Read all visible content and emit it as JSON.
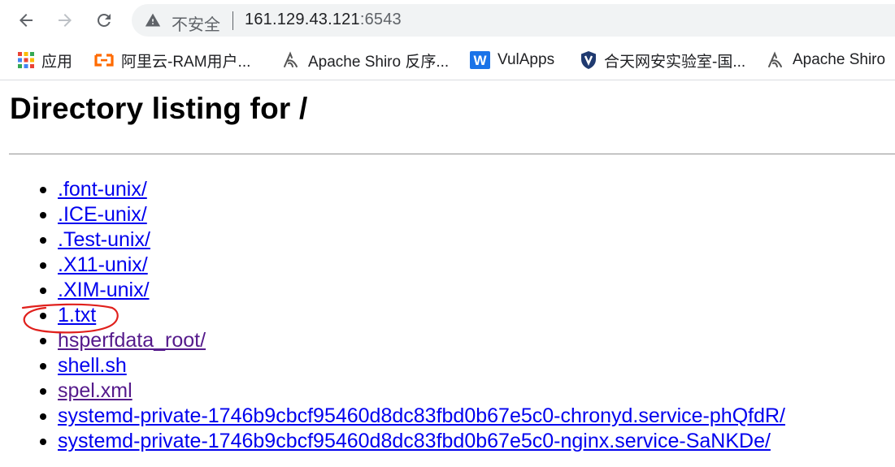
{
  "browser": {
    "security_label": "不安全",
    "url_host": "161.129.43.121",
    "url_port": ":6543",
    "bookmarks": [
      {
        "icon": "apps-grid-icon",
        "label": "应用"
      },
      {
        "icon": "aliyun-icon",
        "label": "阿里云-RAM用户..."
      },
      {
        "icon": "shiro-icon",
        "label": "Apache Shiro 反序..."
      },
      {
        "icon": "w-icon",
        "label": "VulApps"
      },
      {
        "icon": "shield-icon",
        "label": "合天网安实验室-国..."
      },
      {
        "icon": "shiro-icon",
        "label": "Apache Shiro"
      }
    ]
  },
  "page": {
    "title": "Directory listing for /",
    "entries": [
      {
        "name": ".font-unix/",
        "visited": false
      },
      {
        "name": ".ICE-unix/",
        "visited": false
      },
      {
        "name": ".Test-unix/",
        "visited": false
      },
      {
        "name": ".X11-unix/",
        "visited": false
      },
      {
        "name": ".XIM-unix/",
        "visited": false
      },
      {
        "name": "1.txt",
        "visited": false,
        "annotated": true
      },
      {
        "name": "hsperfdata_root/",
        "visited": true
      },
      {
        "name": "shell.sh",
        "visited": false
      },
      {
        "name": "spel.xml",
        "visited": true
      },
      {
        "name": "systemd-private-1746b9cbcf95460d8dc83fbd0b67e5c0-chronyd.service-phQfdR/",
        "visited": false
      },
      {
        "name": "systemd-private-1746b9cbcf95460d8dc83fbd0b67e5c0-nginx.service-SaNKDe/",
        "visited": false
      }
    ],
    "link_color": "#0000ee",
    "visited_color": "#551a8b",
    "annotation_color": "#e0201c"
  }
}
